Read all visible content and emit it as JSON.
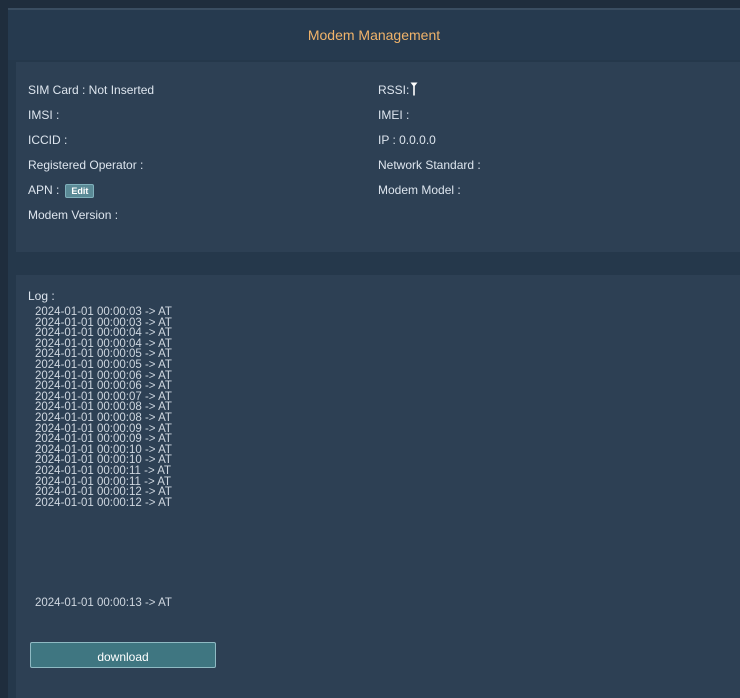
{
  "header": {
    "title": "Modem Management"
  },
  "info": {
    "sim_card": "SIM Card : Not Inserted",
    "rssi": "RSSI:",
    "imsi": "IMSI :",
    "imei": "IMEI :",
    "iccid": "ICCID :",
    "ip": "IP : 0.0.0.0",
    "registered_operator": "Registered Operator :",
    "network_standard": "Network Standard :",
    "apn": "APN :",
    "apn_edit": "Edit",
    "modem_model": "Modem Model :",
    "modem_version": "Modem Version :"
  },
  "log": {
    "label": "Log :",
    "lines": [
      "2024-01-01 00:00:03 -> AT",
      "2024-01-01 00:00:03 -> AT",
      "2024-01-01 00:00:04 -> AT",
      "2024-01-01 00:00:04 -> AT",
      "2024-01-01 00:00:05 -> AT",
      "2024-01-01 00:00:05 -> AT",
      "2024-01-01 00:00:06 -> AT",
      "2024-01-01 00:00:06 -> AT",
      "2024-01-01 00:00:07 -> AT",
      "2024-01-01 00:00:08 -> AT",
      "2024-01-01 00:00:08 -> AT",
      "2024-01-01 00:00:09 -> AT",
      "2024-01-01 00:00:09 -> AT",
      "2024-01-01 00:00:10 -> AT",
      "2024-01-01 00:00:10 -> AT",
      "2024-01-01 00:00:11 -> AT",
      "2024-01-01 00:00:11 -> AT",
      "2024-01-01 00:00:12 -> AT",
      "2024-01-01 00:00:12 -> AT"
    ],
    "last_line": "2024-01-01 00:00:13 -> AT",
    "download_label": "download"
  },
  "colors": {
    "title": "#f0b36a",
    "background": "#1f2d3d",
    "panel": "#2d4054",
    "button": "#3f7681"
  },
  "icons": {
    "rssi": "antenna-icon"
  }
}
